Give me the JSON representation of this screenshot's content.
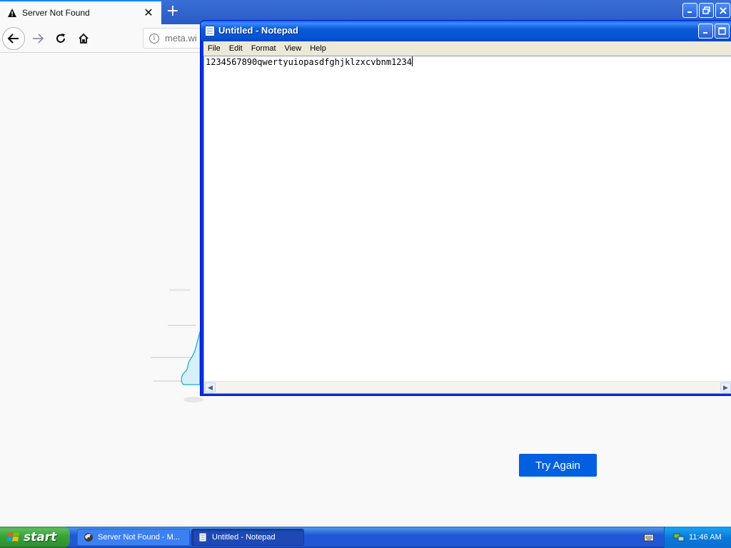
{
  "browser": {
    "tab_title": "Server Not Found",
    "url_text": "meta.wi",
    "try_again_label": "Try Again",
    "icons": {
      "tab_warning": "warning-icon",
      "tab_close": "close-icon",
      "new_tab": "plus-icon",
      "back": "back-arrow-icon",
      "forward": "forward-arrow-icon",
      "reload": "reload-icon",
      "home": "home-icon",
      "site_info": "info-icon"
    }
  },
  "notepad": {
    "title": "Untitled - Notepad",
    "menu": [
      "File",
      "Edit",
      "Format",
      "View",
      "Help"
    ],
    "content": "1234567890qwertyuiopasdfghjklzxcvbnm1234"
  },
  "taskbar": {
    "start_label": "start",
    "tasks": [
      {
        "label": "Server Not Found - M...",
        "icon": "firefox-icon"
      },
      {
        "label": "Untitled - Notepad",
        "icon": "notepad-icon"
      }
    ],
    "clock": "11:46 AM"
  },
  "colors": {
    "firefox_blue": "#0060df",
    "xp_taskbar": "#2157d7",
    "xp_start_green": "#37a337"
  }
}
